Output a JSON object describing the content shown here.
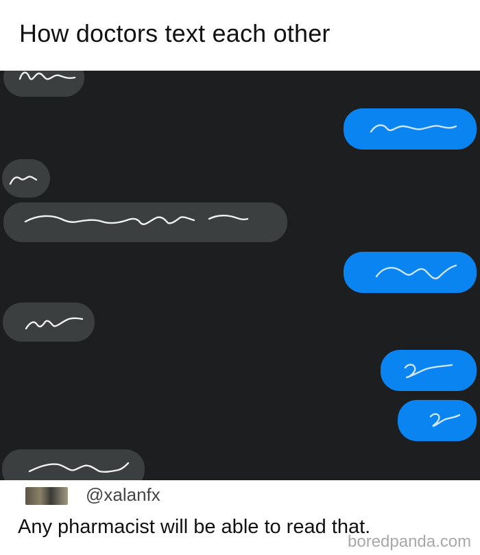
{
  "header": {
    "title": "How doctors text each other"
  },
  "chat": {
    "messages": [
      {
        "side": "received",
        "icon": "scribble-1"
      },
      {
        "side": "sent",
        "icon": "scribble-2"
      },
      {
        "side": "received",
        "icon": "scribble-3"
      },
      {
        "side": "received",
        "icon": "scribble-4"
      },
      {
        "side": "sent",
        "icon": "scribble-5"
      },
      {
        "side": "received",
        "icon": "scribble-6"
      },
      {
        "side": "sent",
        "icon": "scribble-7"
      },
      {
        "side": "sent",
        "icon": "scribble-8"
      },
      {
        "side": "received",
        "icon": "scribble-9"
      }
    ],
    "colors": {
      "background": "#1c1e1f",
      "received_bubble": "#3c3f40",
      "sent_bubble": "#0a84f0"
    }
  },
  "tweet": {
    "handle": "@xalanfx",
    "text": "Any pharmacist will be able to read that.",
    "avatar_icon": "user-avatar"
  },
  "watermark": {
    "text": "boredpanda.com"
  }
}
